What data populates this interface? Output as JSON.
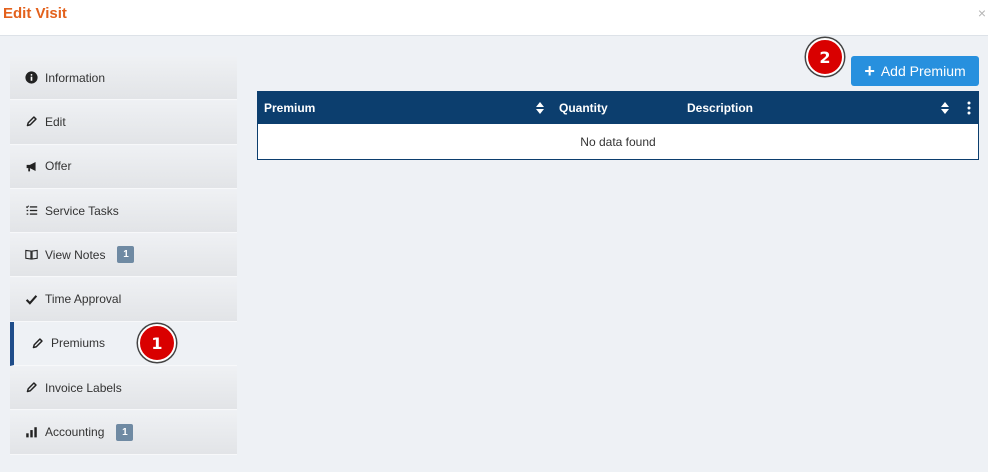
{
  "dialog": {
    "title": "Edit Visit",
    "close": "×"
  },
  "sidebar": {
    "items": [
      {
        "label": "Information",
        "icon": "info-circle-icon"
      },
      {
        "label": "Edit",
        "icon": "pencil-icon"
      },
      {
        "label": "Offer",
        "icon": "megaphone-icon"
      },
      {
        "label": "Service Tasks",
        "icon": "task-list-icon"
      },
      {
        "label": "View Notes",
        "icon": "book-icon",
        "badge": "1"
      },
      {
        "label": "Time Approval",
        "icon": "checkmark-icon"
      },
      {
        "label": "Premiums",
        "icon": "pencil-icon",
        "active": true
      },
      {
        "label": "Invoice Labels",
        "icon": "pencil-icon"
      },
      {
        "label": "Accounting",
        "icon": "bar-chart-icon",
        "badge": "1"
      }
    ]
  },
  "markers": {
    "one": "1",
    "two": "2"
  },
  "toolbar": {
    "add_label": "Add Premium",
    "plus": "+"
  },
  "table": {
    "columns": [
      {
        "label": "Premium",
        "sortable": true
      },
      {
        "label": "Quantity",
        "sortable": false
      },
      {
        "label": "Description",
        "sortable": true
      }
    ],
    "empty_message": "No data found"
  },
  "colors": {
    "title": "#e3611c",
    "header_bg": "#0c3e6e",
    "button": "#2790de",
    "active_indicator": "#1f4d8a",
    "marker": "#d90000",
    "badge": "#6f8aa3"
  }
}
